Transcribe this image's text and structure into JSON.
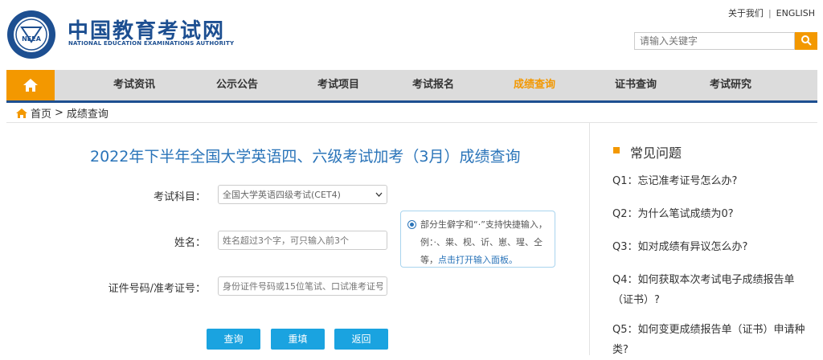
{
  "header": {
    "site_name": "中国教育考试网",
    "site_subtitle": "NATIONAL EDUCATION EXAMINATIONS AUTHORITY",
    "logo_text": "NEEA",
    "top_links": [
      "关于我们",
      "ENGLISH"
    ],
    "top_links_separator": "|",
    "search_placeholder": "请输入关键字"
  },
  "nav": {
    "items": [
      "考试资讯",
      "公示公告",
      "考试项目",
      "考试报名",
      "成绩查询",
      "证书查询",
      "考试研究"
    ],
    "active": "成绩查询"
  },
  "breadcrumb": {
    "home": "首页",
    "separator": ">",
    "current": "成绩查询"
  },
  "form": {
    "title": "2022年下半年全国大学英语四、六级考试加考（3月）成绩查询",
    "subject_label": "考试科目：",
    "subject_value": "全国大学英语四级考试(CET4)",
    "name_label": "姓名：",
    "name_placeholder": "姓名超过3个字，可只输入前3个",
    "id_label": "证件号码/准考证号：",
    "id_placeholder": "身份证件号码或15位笔试、口试准考证号",
    "tip_text": "部分生僻字和“·”支持快捷输入，例：·、粜、枧、䜣、崽、瑆、仝等，",
    "tip_link": "点击打开输入面板。",
    "buttons": {
      "query": "查询",
      "reset": "重填",
      "back": "返回"
    }
  },
  "faq": {
    "title": "常见问题",
    "items": [
      "Q1：忘记准考证号怎么办?",
      "Q2：为什么笔试成绩为0?",
      "Q3：如对成绩有异议怎么办?",
      "Q4：如何获取本次考试电子成绩报告单（证书）?",
      "Q5：如何变更成绩报告单（证书）申请种类?"
    ]
  },
  "colors": {
    "brand_blue": "#1d4f91",
    "accent_orange": "#f39800",
    "button_blue": "#1aa3e0",
    "title_blue": "#2a74b9"
  }
}
